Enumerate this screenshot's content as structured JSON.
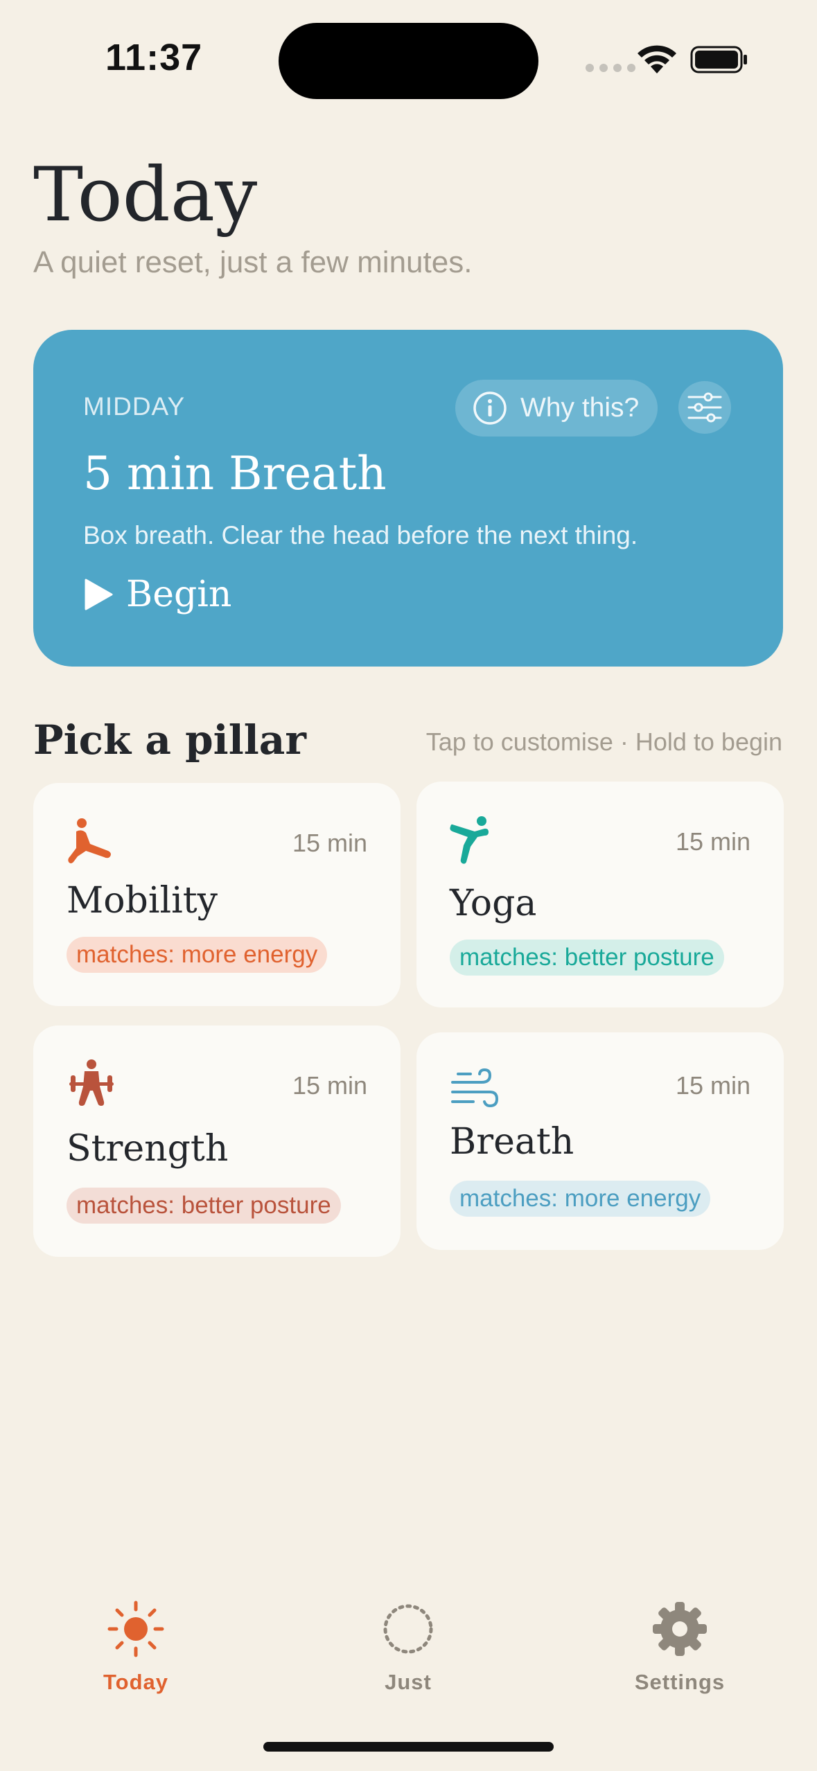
{
  "status": {
    "time": "11:37"
  },
  "header": {
    "title": "Today",
    "subtitle": "A quiet reset, just a few minutes."
  },
  "hero": {
    "tag": "MIDDAY",
    "why_label": "Why this?",
    "title": "5 min Breath",
    "description": "Box breath. Clear the head before the next thing.",
    "begin_label": "Begin",
    "color": "#4fa6c8"
  },
  "section": {
    "title": "Pick a pillar",
    "hint": "Tap to customise · Hold to begin"
  },
  "pillars": [
    {
      "name": "Mobility",
      "duration": "15 min",
      "badge": "matches: more energy",
      "icon": "stretch-icon",
      "color": "#e0622f",
      "badge_bg": "#fadcd0"
    },
    {
      "name": "Yoga",
      "duration": "15 min",
      "badge": "matches: better posture",
      "icon": "yoga-pose-icon",
      "color": "#19a999",
      "badge_bg": "#d4efe9"
    },
    {
      "name": "Strength",
      "duration": "15 min",
      "badge": "matches: better posture",
      "icon": "weightlifter-icon",
      "color": "#b9533c",
      "badge_bg": "#f3ddd6"
    },
    {
      "name": "Breath",
      "duration": "15 min",
      "badge": "matches: more energy",
      "icon": "wind-icon",
      "color": "#4c9ec1",
      "badge_bg": "#dcecf1"
    }
  ],
  "tabs": [
    {
      "label": "Today",
      "icon": "sun-icon",
      "active": true,
      "color": "#e0622f"
    },
    {
      "label": "Just",
      "icon": "dotted-circle-icon",
      "active": false,
      "color": "#8e877c"
    },
    {
      "label": "Settings",
      "icon": "gear-icon",
      "active": false,
      "color": "#8e877c"
    }
  ]
}
